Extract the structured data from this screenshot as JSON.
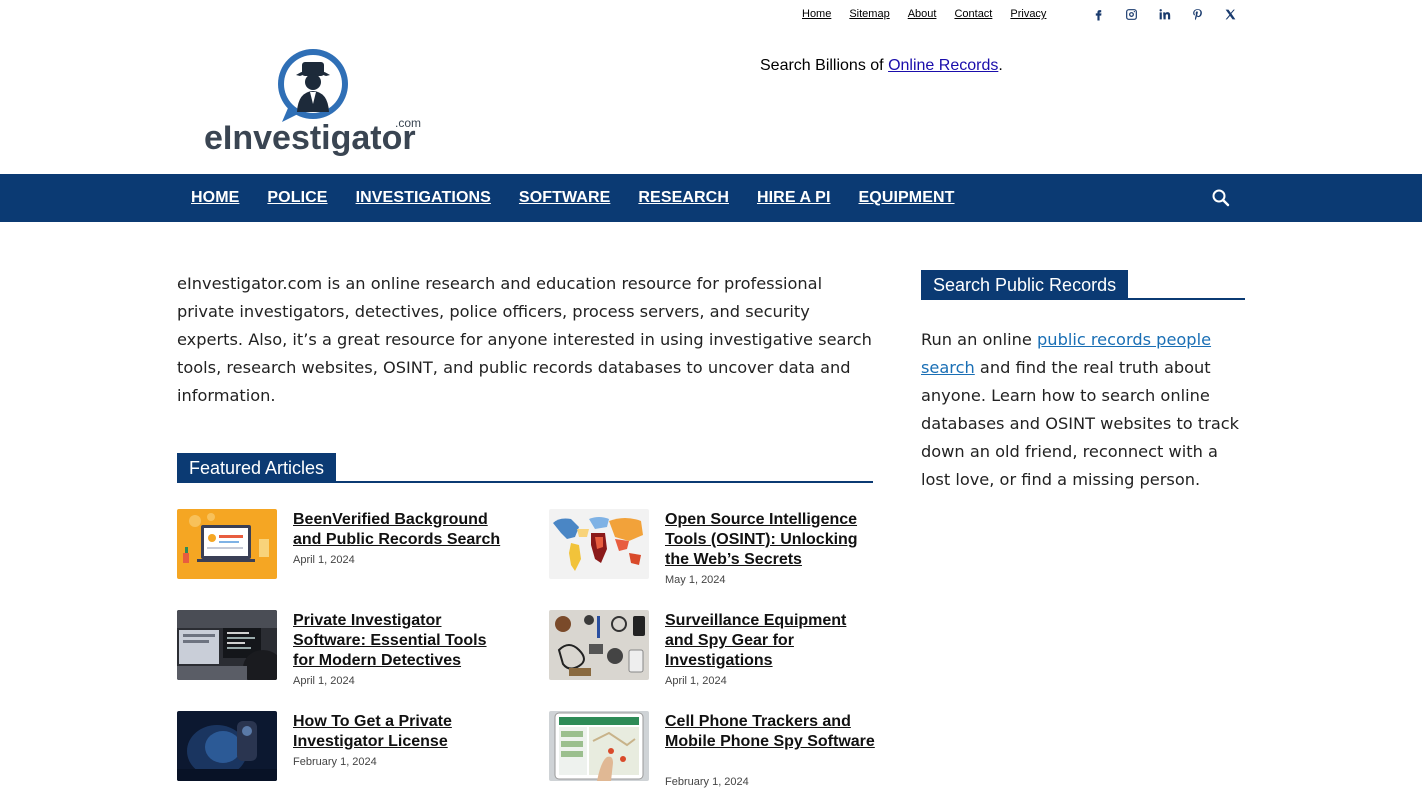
{
  "top_links": [
    "Home",
    "Sitemap",
    "About",
    "Contact",
    "Privacy"
  ],
  "social_icons": [
    "facebook-icon",
    "instagram-icon",
    "linkedin-icon",
    "pinterest-icon",
    "x-icon"
  ],
  "logo": {
    "text": "eInvestigator",
    "suffix": ".com"
  },
  "tagline": {
    "prefix": "Search Billions of ",
    "link": "Online Records",
    "suffix": "."
  },
  "nav": [
    "HOME",
    "POLICE",
    "INVESTIGATIONS",
    "SOFTWARE",
    "RESEARCH",
    "HIRE A PI",
    "EQUIPMENT"
  ],
  "intro": "eInvestigator.com is an online research and education resource for professional private investigators, detectives, police officers, process servers, and security experts. Also, it’s a great resource for anyone interested in using investigative search tools, research websites, OSINT, and public records databases to uncover data and information.",
  "featured": {
    "heading": "Featured Articles",
    "articles": [
      {
        "title": "BeenVerified Background and Public Records Search",
        "date": "April 1, 2024"
      },
      {
        "title": "Open Source Intelligence Tools (OSINT): Unlocking the Web’s Secrets",
        "date": "May 1, 2024"
      },
      {
        "title": "Private Investigator Software: Essential Tools for Modern Detectives",
        "date": "April 1, 2024"
      },
      {
        "title": "Surveillance Equipment and Spy Gear for Investigations",
        "date": "April 1, 2024"
      },
      {
        "title": "How To Get a Private Investigator License",
        "date": "February 1, 2024"
      },
      {
        "title": "Cell Phone Trackers and Mobile Phone Spy Software",
        "date": "February 1, 2024"
      }
    ]
  },
  "sidebar": {
    "heading": "Search Public Records",
    "text_before": "Run an online ",
    "link": "public records people search",
    "text_after": " and find the real truth about anyone. Learn how to search online databases and OSINT websites to track down an old friend, reconnect with a lost love, or find a missing person."
  },
  "colors": {
    "brand": "#0b3a73",
    "link": "#1a0dab",
    "sidebar_link": "#1a6fb5"
  }
}
